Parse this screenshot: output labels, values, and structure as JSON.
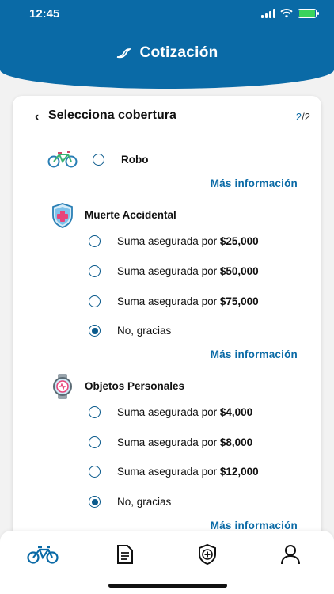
{
  "status_bar": {
    "time": "12:45"
  },
  "header": {
    "title": "Cotización"
  },
  "card": {
    "title": "Selecciona cobertura",
    "pager_current": "2",
    "pager_total": "/2"
  },
  "sections": [
    {
      "title": "Robo",
      "more_label": "Más información"
    },
    {
      "title": "Muerte Accidental",
      "options": [
        {
          "prefix": "Suma asegurada por ",
          "amount": "$25,000",
          "selected": false
        },
        {
          "prefix": "Suma asegurada por ",
          "amount": "$50,000",
          "selected": false
        },
        {
          "prefix": "Suma asegurada por ",
          "amount": "$75,000",
          "selected": false
        },
        {
          "prefix": "No, gracias",
          "amount": "",
          "selected": true
        }
      ],
      "more_label": "Más información"
    },
    {
      "title": "Objetos Personales",
      "options": [
        {
          "prefix": "Suma asegurada por ",
          "amount": "$4,000",
          "selected": false
        },
        {
          "prefix": "Suma asegurada por ",
          "amount": "$8,000",
          "selected": false
        },
        {
          "prefix": "Suma asegurada por ",
          "amount": "$12,000",
          "selected": false
        },
        {
          "prefix": "No, gracias",
          "amount": "",
          "selected": true
        }
      ],
      "more_label": "Más información"
    }
  ],
  "tabbar": [
    "bicycle-icon",
    "document-icon",
    "shield-icon",
    "user-icon"
  ],
  "colors": {
    "primary": "#0a6aa6",
    "radio": "#0a5a8c"
  }
}
